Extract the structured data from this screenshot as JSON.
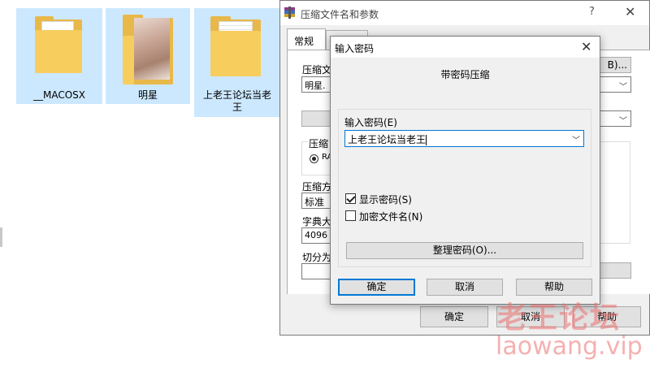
{
  "explorer": {
    "files": [
      {
        "name": "__MACOSX",
        "type": "folder"
      },
      {
        "name": "明星",
        "type": "folder-photo"
      },
      {
        "name": "上老王论坛当老王",
        "type": "folder"
      }
    ]
  },
  "main_dialog": {
    "title": "压缩文件名和参数",
    "help_glyph": "?",
    "close_glyph": "✕",
    "tabs": [
      "常规"
    ],
    "archive_name_label": "压缩文",
    "archive_name_value": "明星.",
    "browse_label": "B)...",
    "format_group_label": "压缩",
    "format_option": "RA",
    "method_label": "压缩方",
    "method_value": "标准",
    "dict_label": "字典大",
    "dict_value": "4096",
    "split_label": "切分为",
    "ok_label": "确定",
    "cancel_label": "取消",
    "help_label": "帮助"
  },
  "password_dialog": {
    "title": "输入密码",
    "close_glyph": "✕",
    "subtitle": "带密码压缩",
    "input_label": "输入密码(E)",
    "input_value": "上老王论坛当老王",
    "show_password_label": "显示密码(S)",
    "show_password_checked": true,
    "encrypt_names_label": "加密文件名(N)",
    "encrypt_names_checked": false,
    "organize_label": "整理密码(O)...",
    "ok_label": "确定",
    "cancel_label": "取消",
    "help_label": "帮助"
  },
  "watermark": {
    "line1": "老王论坛",
    "line2": "laowang.vip"
  }
}
